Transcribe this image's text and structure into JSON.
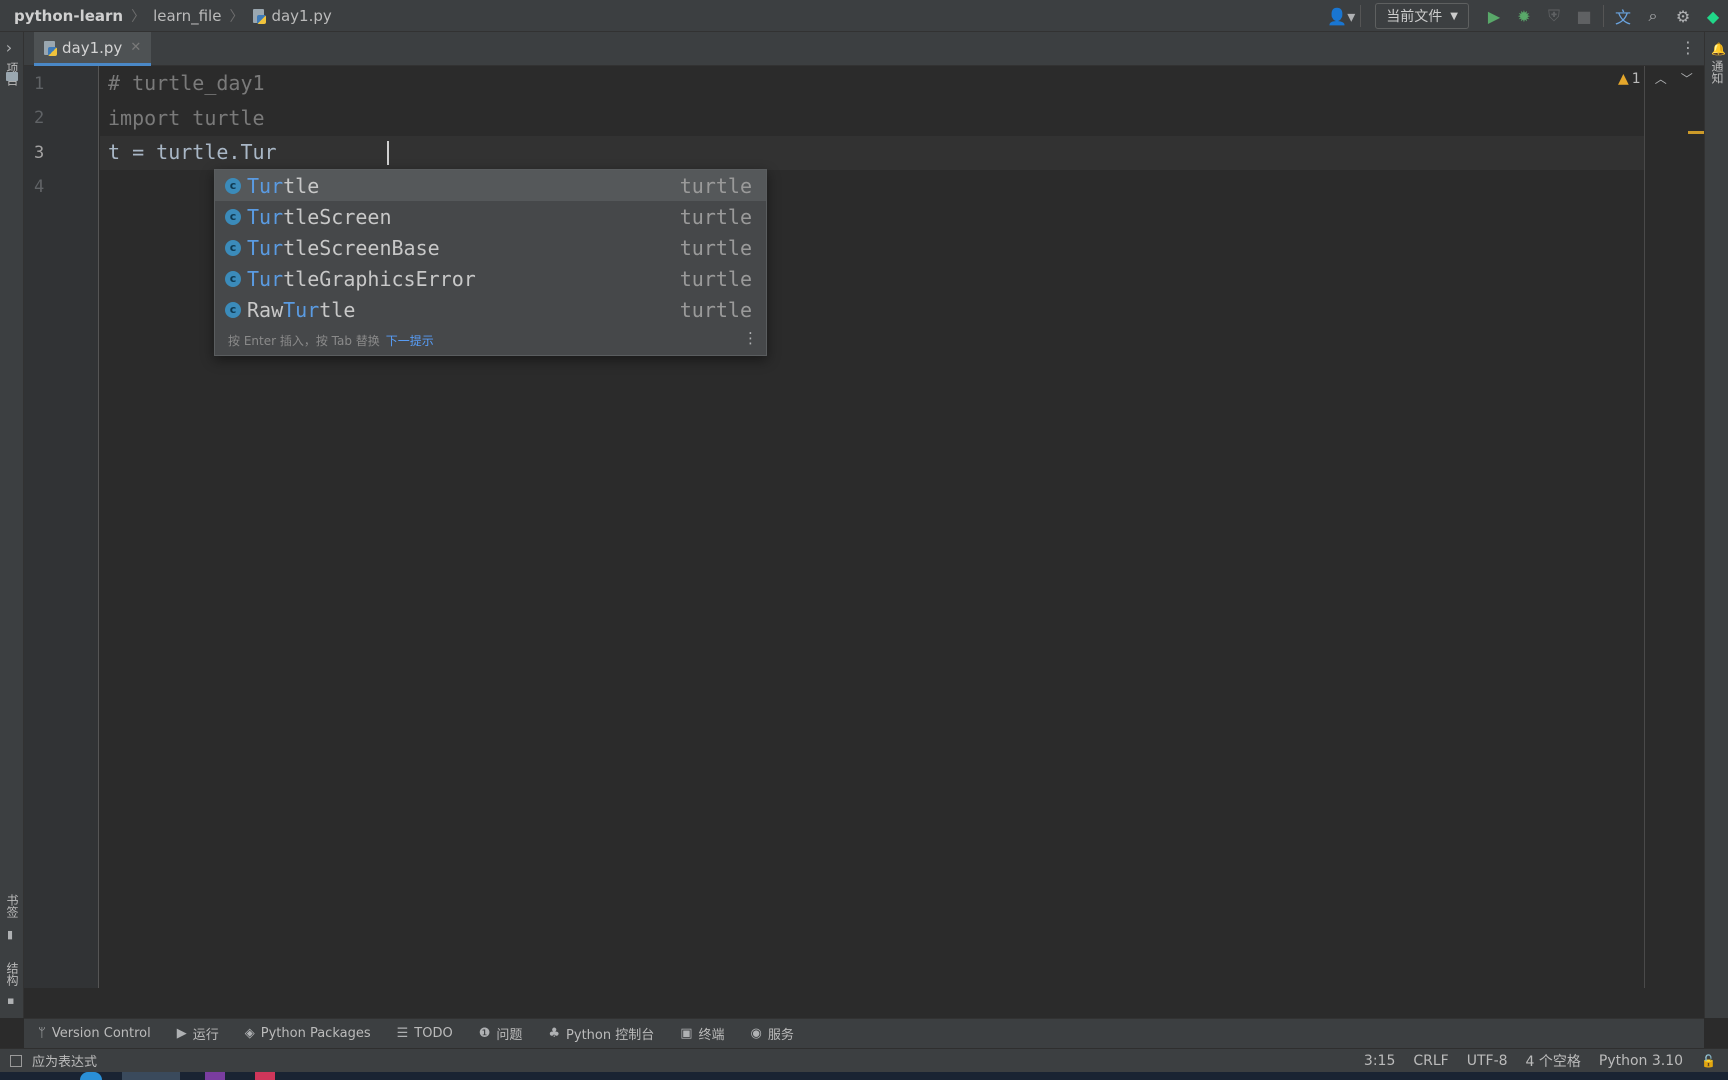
{
  "navbar": {
    "breadcrumb": [
      "python-learn",
      "learn_file",
      "day1.py"
    ],
    "run_config": "当前文件"
  },
  "left_strip": {
    "project_label": "项目",
    "bookmarks_label": "书签",
    "structure_label": "结构"
  },
  "right_strip": {
    "notifications_label": "通知"
  },
  "tabs": [
    {
      "label": "day1.py",
      "close": "✕"
    }
  ],
  "editor": {
    "line_numbers": [
      "1",
      "2",
      "3",
      "4"
    ],
    "lines": [
      "# turtle_day1",
      "import turtle",
      "t = turtle.Tur",
      ""
    ],
    "inspection_count": "1"
  },
  "completion": {
    "items": [
      {
        "prefix": "",
        "match": "Tur",
        "rest": "tle",
        "type": "turtle"
      },
      {
        "prefix": "",
        "match": "Tur",
        "rest": "tleScreen",
        "type": "turtle"
      },
      {
        "prefix": "",
        "match": "Tur",
        "rest": "tleScreenBase",
        "type": "turtle"
      },
      {
        "prefix": "",
        "match": "Tur",
        "rest": "tleGraphicsError",
        "type": "turtle"
      },
      {
        "prefix": "Raw",
        "match": "Tur",
        "rest": "tle",
        "type": "turtle"
      }
    ],
    "icon_letter": "c",
    "footer_hint": "按 Enter 插入，按 Tab 替换",
    "footer_link": "下一提示"
  },
  "toolwindows": [
    {
      "label": "Version Control",
      "icon": "branch-icon"
    },
    {
      "label": "运行",
      "icon": "run-icon"
    },
    {
      "label": "Python Packages",
      "icon": "layers-icon"
    },
    {
      "label": "TODO",
      "icon": "list-icon"
    },
    {
      "label": "问题",
      "icon": "info-icon"
    },
    {
      "label": "Python 控制台",
      "icon": "python-icon"
    },
    {
      "label": "终端",
      "icon": "terminal-icon"
    },
    {
      "label": "服务",
      "icon": "play-circle-icon"
    }
  ],
  "status": {
    "message": "应为表达式",
    "position": "3:15",
    "line_ending": "CRLF",
    "encoding": "UTF-8",
    "indent": "4 个空格",
    "interpreter": "Python 3.10"
  },
  "colors": {
    "accent": "#4a88c7",
    "match": "#5a9be2",
    "run": "#59a869",
    "warning": "#e5a72b"
  }
}
